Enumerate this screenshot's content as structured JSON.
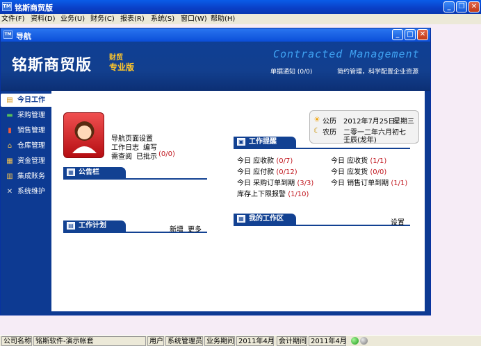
{
  "app": {
    "title": "铭斯商贸版",
    "logo_text": "TM"
  },
  "menubar": {
    "items": [
      "文件(F)",
      "资料(D)",
      "业务(U)",
      "财务(C)",
      "报表(R)",
      "系统(S)",
      "窗口(W)",
      "帮助(H)"
    ]
  },
  "nav_window": {
    "title": "导航",
    "logo_text": "TM"
  },
  "banner": {
    "brand_name": "铭斯商贸版",
    "brand_sub1": "财贸",
    "brand_sub2": "专业版",
    "slogan_en": "Contracted Management",
    "doc_notice": "单据通知 (0/0)",
    "slogan_cn": "简约管理，科学配置企业资源"
  },
  "side_nav": {
    "items": [
      {
        "label": "今日工作",
        "icon": "clipboard-icon",
        "active": true
      },
      {
        "label": "采购管理",
        "icon": "cart-icon",
        "active": false
      },
      {
        "label": "销售管理",
        "icon": "bar-chart-icon",
        "active": false
      },
      {
        "label": "仓库管理",
        "icon": "house-icon",
        "active": false
      },
      {
        "label": "资金管理",
        "icon": "money-icon",
        "active": false
      },
      {
        "label": "集成账务",
        "icon": "ledger-icon",
        "active": false
      },
      {
        "label": "系统维护",
        "icon": "tools-icon",
        "active": false
      }
    ]
  },
  "profile": {
    "page_settings": "导航页面设置",
    "work_log": "工作日志",
    "edit": "编写",
    "pending_review": "需查阅",
    "approved": "已批示",
    "approved_count": "(0/0)"
  },
  "calendar": {
    "solar_label": "公历",
    "solar_date": "2012年7月25日",
    "weekday": "星期三",
    "lunar_label": "农历",
    "lunar_date": "二零一二年六月初七",
    "lunar_year": "壬辰(龙年)"
  },
  "announcement": {
    "title": "公告栏"
  },
  "work_plan": {
    "title": "工作计划",
    "add": "新增",
    "more": "更多"
  },
  "reminders": {
    "title": "工作提醒",
    "items": [
      {
        "label": "今日 应收款",
        "count": "(0/7)"
      },
      {
        "label": "今日 应收货",
        "count": "(1/1)"
      },
      {
        "label": "今日 应付款",
        "count": "(0/12)"
      },
      {
        "label": "今日 应发货",
        "count": "(0/0)"
      },
      {
        "label": "今日 采购订单到期",
        "count": "(3/3)"
      },
      {
        "label": "今日 销售订单到期",
        "count": "(1/1)"
      },
      {
        "label": "库存上下限报警",
        "count": "(1/10)"
      }
    ]
  },
  "workspace": {
    "title": "我的工作区",
    "settings": "设置"
  },
  "statusbar": {
    "company_label": "公司名称",
    "company_value": "铭斯软件-演示帐套",
    "user_label": "用户",
    "user_value": "系统管理员",
    "period_label": "业务期间",
    "period_value": "2011年4月",
    "acct_label": "会计期间",
    "acct_value": "2011年4月"
  },
  "colors": {
    "nav_blue": "#0d3a92",
    "section_blue": "#124192",
    "accent_red": "#c0141c",
    "gold": "#ffc62a",
    "slogan_blue": "#3fa2f2"
  }
}
